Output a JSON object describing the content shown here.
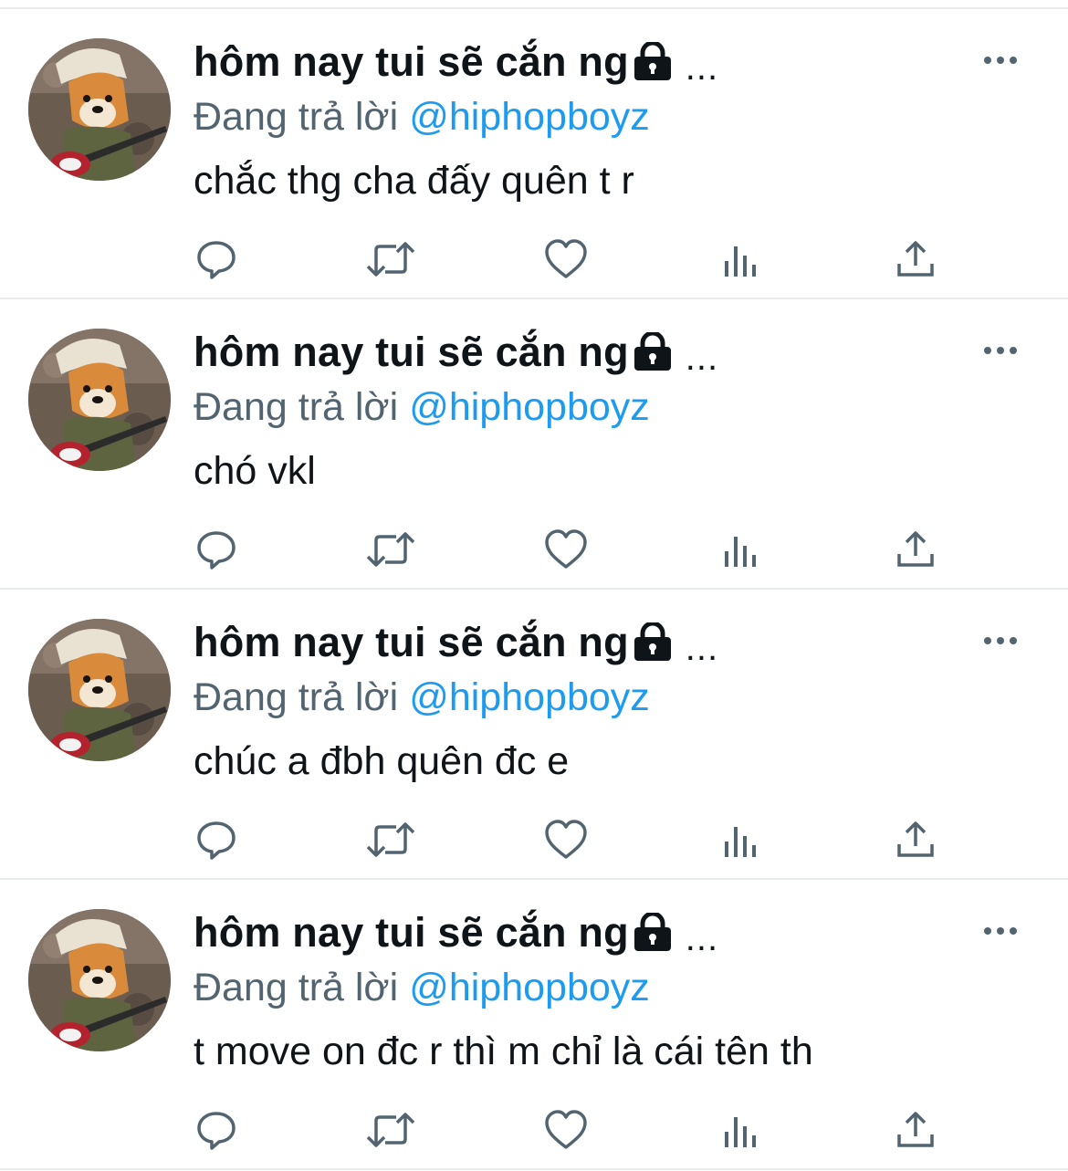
{
  "colors": {
    "name": "#0f1419",
    "secondary": "#536471",
    "link": "#1d9bf0",
    "icon": "#536471",
    "divider": "#e9ecee"
  },
  "icons": {
    "lock": "lock-icon",
    "more": "more-horizontal-icon",
    "reply": "reply-bubble-icon",
    "retweet": "retweet-icon",
    "like": "heart-icon",
    "views": "bar-chart-icon",
    "share": "share-upload-icon"
  },
  "tweets": [
    {
      "display_name": "hôm nay tui sẽ cắn ng",
      "truncation": "...",
      "reply_prefix": "Đang trả lời",
      "reply_handle": "@hiphopboyz",
      "text": "chắc thg cha đấy quên t r"
    },
    {
      "display_name": "hôm nay tui sẽ cắn ng",
      "truncation": "...",
      "reply_prefix": "Đang trả lời",
      "reply_handle": "@hiphopboyz",
      "text": "chó vkl"
    },
    {
      "display_name": "hôm nay tui sẽ cắn ng",
      "truncation": "...",
      "reply_prefix": "Đang trả lời",
      "reply_handle": "@hiphopboyz",
      "text": "chúc a đbh quên đc e"
    },
    {
      "display_name": "hôm nay tui sẽ cắn ng",
      "truncation": "...",
      "reply_prefix": "Đang trả lời",
      "reply_handle": "@hiphopboyz",
      "text": "t move on đc r thì m chỉ là cái tên th"
    }
  ]
}
